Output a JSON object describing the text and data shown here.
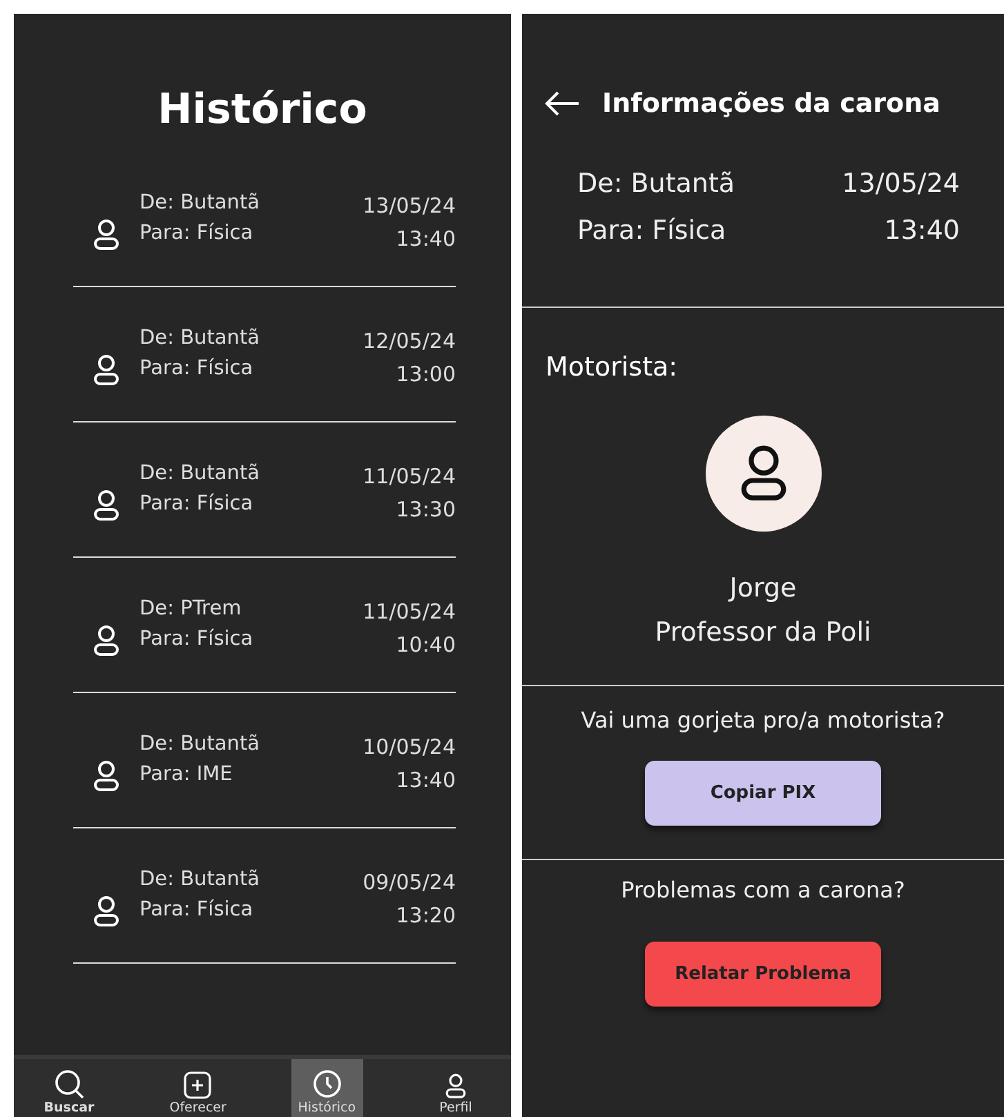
{
  "history": {
    "title": "Histórico",
    "rides": [
      {
        "from": "De: Butantã",
        "to": "Para: Física",
        "date": "13/05/24",
        "time": "13:40"
      },
      {
        "from": "De: Butantã",
        "to": "Para: Física",
        "date": "12/05/24",
        "time": "13:00"
      },
      {
        "from": "De: Butantã",
        "to": "Para: Física",
        "date": "11/05/24",
        "time": "13:30"
      },
      {
        "from": "De: PTrem",
        "to": "Para: Física",
        "date": "11/05/24",
        "time": "10:40"
      },
      {
        "from": "De: Butantã",
        "to": "Para: IME",
        "date": "10/05/24",
        "time": "13:40"
      },
      {
        "from": "De: Butantã",
        "to": "Para: Física",
        "date": "09/05/24",
        "time": "13:20"
      }
    ],
    "nav": [
      {
        "kind": "search",
        "label": "Buscar",
        "selected": false,
        "bold": true
      },
      {
        "kind": "add",
        "label": "Oferecer",
        "selected": false,
        "bold": false
      },
      {
        "kind": "clock",
        "label": "Histórico",
        "selected": true,
        "bold": false
      },
      {
        "kind": "person",
        "label": "Perfil",
        "selected": false,
        "bold": false
      }
    ]
  },
  "details": {
    "title": "Informações da carona",
    "from": "De: Butantã",
    "to": "Para: Física",
    "date": "13/05/24",
    "time": "13:40",
    "driver_heading": "Motorista:",
    "driver_name": "Jorge",
    "driver_role": "Professor da Poli",
    "tip_question": "Vai uma gorjeta pro/a motorista?",
    "tip_button": "Copiar PIX",
    "problem_question": "Problemas com a carona?",
    "problem_button": "Relatar Problema"
  }
}
